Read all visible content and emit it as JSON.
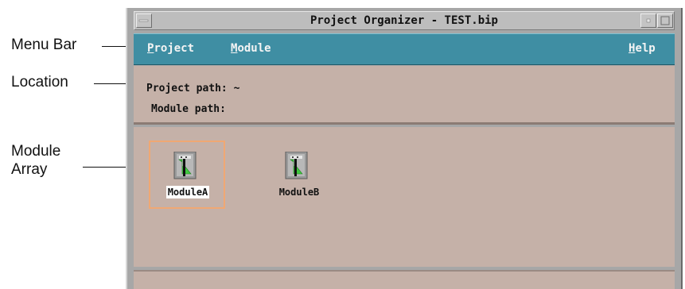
{
  "callouts": {
    "menu_bar": "Menu Bar",
    "location": "Location",
    "module_array_line1": "Module",
    "module_array_line2": "Array"
  },
  "window": {
    "title": "Project Organizer - TEST.bip",
    "minimize_icon": "minimize-icon",
    "maximize_icon": "maximize-icon",
    "menu_icon": "window-menu-icon"
  },
  "menubar": {
    "project": {
      "mnemonic": "P",
      "rest": "roject"
    },
    "module": {
      "mnemonic": "M",
      "rest": "odule"
    },
    "help": {
      "mnemonic": "H",
      "rest": "elp"
    }
  },
  "location": {
    "project_path_label": "Project path:",
    "project_path_value": "~",
    "module_path_label": "Module path:",
    "module_path_value": ""
  },
  "modules": [
    {
      "name": "ModuleA",
      "selected": true,
      "icon": "module-icon"
    },
    {
      "name": "ModuleB",
      "selected": false,
      "icon": "module-icon"
    }
  ],
  "colors": {
    "menubar_bg": "#3f8ea3",
    "panel_bg": "#c5b1a8",
    "selection_frame": "#f0a873"
  }
}
